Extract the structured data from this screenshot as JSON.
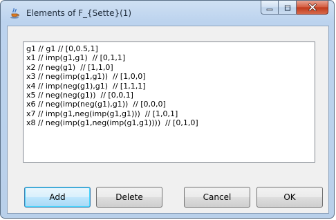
{
  "window": {
    "title": "Elements of F_{Sette}(1)",
    "icon": "java-coffee-icon"
  },
  "caption_buttons": {
    "minimize": "minimize-icon",
    "maximize": "maximize-icon",
    "close": "close-icon"
  },
  "elements_list": [
    "g1 // g1 // [0,0.5,1]",
    "x1 // imp(g1,g1)  // [0,1,1]",
    "x2 // neg(g1)  // [1,1,0]",
    "x3 // neg(imp(g1,g1))  // [1,0,0]",
    "x4 // imp(neg(g1),g1)  // [1,1,1]",
    "x5 // neg(neg(g1))  // [0,0,1]",
    "x6 // neg(imp(neg(g1),g1))  // [0,0,0]",
    "x7 // imp(g1,neg(imp(g1,g1)))  // [1,0,1]",
    "x8 // neg(imp(g1,neg(imp(g1,g1))))  // [0,1,0]"
  ],
  "buttons": {
    "add": "Add",
    "delete": "Delete",
    "cancel": "Cancel",
    "ok": "OK"
  },
  "colors": {
    "window_frame": "#b9d0ea",
    "close_button": "#c0391b",
    "default_button_border": "#3c7fb1"
  }
}
